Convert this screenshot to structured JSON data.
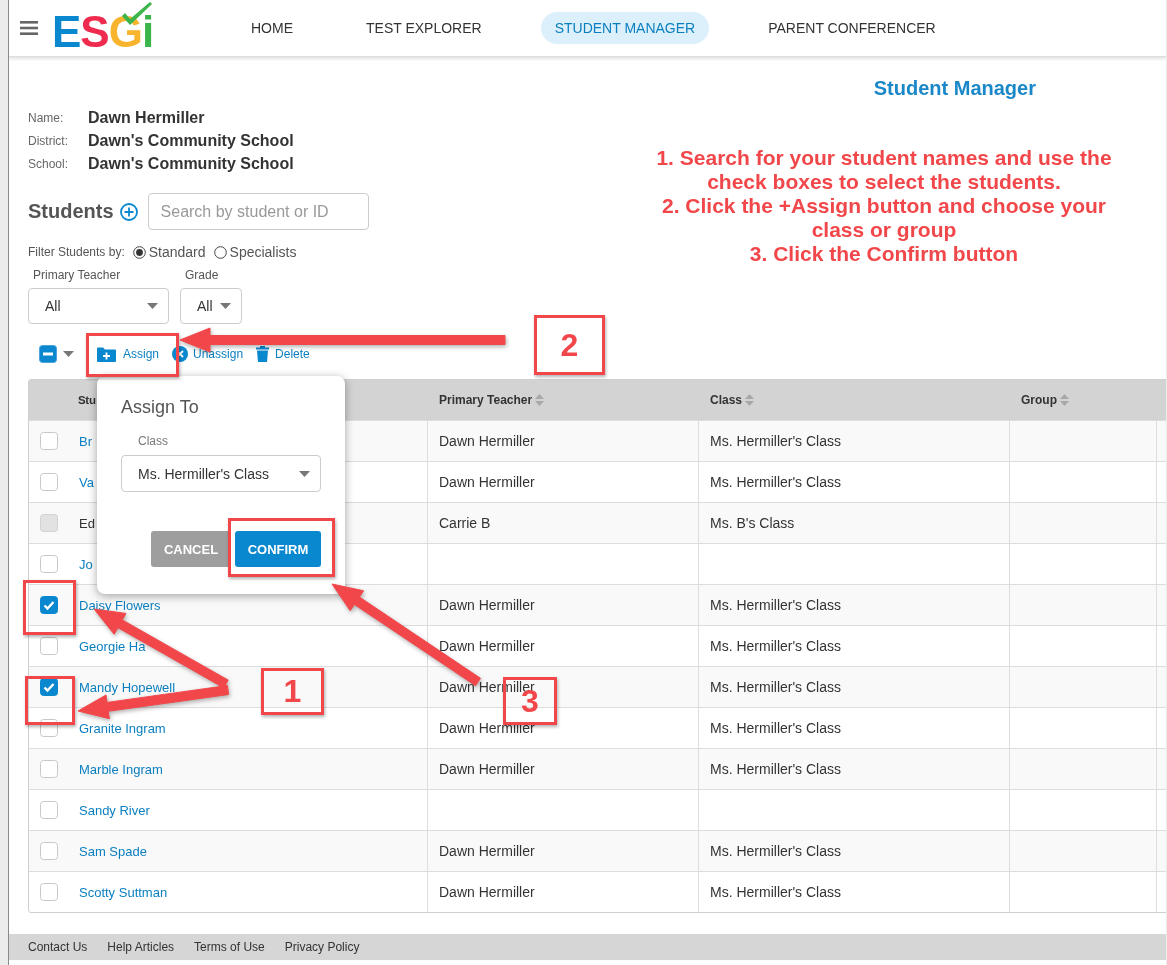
{
  "header": {
    "logo": "ESGi",
    "nav": [
      {
        "label": "HOME",
        "selected": false
      },
      {
        "label": "TEST EXPLORER",
        "selected": false
      },
      {
        "label": "STUDENT MANAGER",
        "selected": true
      },
      {
        "label": "PARENT CONFERENCER",
        "selected": false
      }
    ]
  },
  "page_title": "Student Manager",
  "profile": [
    {
      "label": "Name:",
      "value": "Dawn Hermiller"
    },
    {
      "label": "District:",
      "value": "Dawn's Community School"
    },
    {
      "label": "School:",
      "value": "Dawn's Community School"
    }
  ],
  "instructions": [
    "1. Search for your student names and use the check boxes to select the students.",
    "2. Click the +Assign button and choose your class or group",
    "3. Click the Confirm button"
  ],
  "students": {
    "title": "Students",
    "search_placeholder": "Search by student or ID"
  },
  "filter": {
    "label": "Filter Students by:",
    "options": [
      {
        "label": "Standard",
        "selected": true
      },
      {
        "label": "Specialists",
        "selected": false
      }
    ]
  },
  "dropdowns": [
    {
      "label": "Primary Teacher",
      "value": "All"
    },
    {
      "label": "Grade",
      "value": "All"
    }
  ],
  "toolbar": {
    "select_all": {
      "indeterminate": true
    },
    "actions": [
      {
        "kind": "assign",
        "label": "Assign"
      },
      {
        "kind": "unassign",
        "label": "Unassign"
      },
      {
        "kind": "delete",
        "label": "Delete"
      }
    ]
  },
  "table": {
    "columns": [
      {
        "label": "Stu",
        "sortable": false
      },
      {
        "label": "Primary Teacher",
        "sortable": true
      },
      {
        "label": "Class",
        "sortable": true
      },
      {
        "label": "Group",
        "sortable": true
      }
    ],
    "rows": [
      {
        "name": "Br",
        "checked": false,
        "disabled": false,
        "teacher": "Dawn Hermiller",
        "class": "Ms. Hermiller's Class"
      },
      {
        "name": "Va",
        "checked": false,
        "disabled": false,
        "teacher": "Dawn Hermiller",
        "class": "Ms. Hermiller's Class"
      },
      {
        "name": "Ed",
        "checked": false,
        "disabled": true,
        "teacher": "Carrie B",
        "class": "Ms. B's Class"
      },
      {
        "name": "Jo",
        "checked": false,
        "disabled": false
      },
      {
        "name": "Daisy Flowers",
        "checked": true,
        "disabled": false,
        "teacher": "Dawn Hermiller",
        "class": "Ms. Hermiller's Class"
      },
      {
        "name": "Georgie Ha",
        "checked": false,
        "disabled": false,
        "teacher": "Dawn Hermiller",
        "class": "Ms. Hermiller's Class"
      },
      {
        "name": "Mandy Hopewell",
        "checked": true,
        "disabled": false,
        "teacher": "Dawn Hermiller",
        "class": "Ms. Hermiller's Class"
      },
      {
        "name": "Granite Ingram",
        "checked": false,
        "disabled": false,
        "teacher": "Dawn Hermiller",
        "class": "Ms. Hermiller's Class"
      },
      {
        "name": "Marble Ingram",
        "checked": false,
        "disabled": false,
        "teacher": "Dawn Hermiller",
        "class": "Ms. Hermiller's Class"
      },
      {
        "name": "Sandy River",
        "checked": false,
        "disabled": false
      },
      {
        "name": "Sam Spade",
        "checked": false,
        "disabled": false,
        "teacher": "Dawn Hermiller",
        "class": "Ms. Hermiller's Class"
      },
      {
        "name": "Scotty Suttman",
        "checked": false,
        "disabled": false,
        "teacher": "Dawn Hermiller",
        "class": "Ms. Hermiller's Class"
      }
    ]
  },
  "dialog": {
    "title": "Assign To",
    "field_label": "Class",
    "value": "Ms. Hermiller's Class",
    "buttons": [
      {
        "kind": "cancel",
        "label": "CANCEL"
      },
      {
        "kind": "confirm",
        "label": "CONFIRM"
      }
    ]
  },
  "footer": {
    "links": [
      "Contact Us",
      "Help Articles",
      "Terms of Use",
      "Privacy Policy"
    ]
  },
  "annotations": {
    "callouts": [
      {
        "label": "1"
      },
      {
        "label": "2"
      },
      {
        "label": "3"
      }
    ]
  }
}
